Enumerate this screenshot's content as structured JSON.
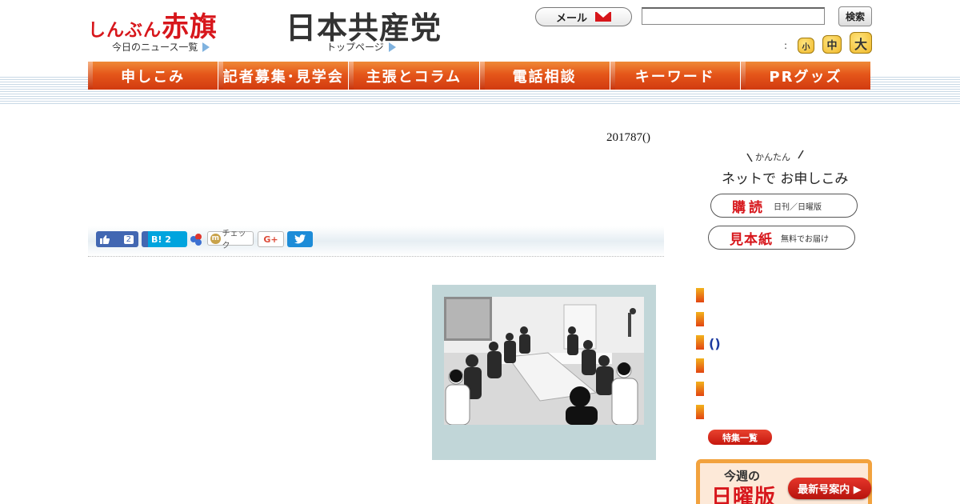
{
  "header": {
    "logo_small": "しんぶん",
    "logo_big": "赤旗",
    "news_link": "今日のニュース一覧",
    "party_logo": "日本共産党",
    "top_link": "トップページ",
    "mail_label": "メール",
    "search_placeholder": "",
    "search_button": "検索",
    "font_size_colon": ":",
    "font_small": "小",
    "font_medium": "中",
    "font_large": "大"
  },
  "nav": {
    "items": [
      {
        "label": "申しこみ"
      },
      {
        "label": "記者募集･見学会"
      },
      {
        "label": "主張とコラム"
      },
      {
        "label": "電話相談"
      },
      {
        "label": "キーワード"
      },
      {
        "label": "PRグッズ"
      }
    ]
  },
  "article": {
    "date": "201787()"
  },
  "share": {
    "like_count": "2",
    "hatena_label": "B!",
    "hatena_count": "2",
    "check_label": "チェック",
    "gplus_label": "G+"
  },
  "sidebar": {
    "kantan": "かんたん",
    "net_prefix": "ネットで",
    "net_suffix": "お申しこみ",
    "subscribe_main": "購読",
    "subscribe_sub": "日刊／日曜版",
    "sample_main": "見本紙",
    "sample_sub": "無料でお届け",
    "paren_text": "()",
    "feature_button": "特集一覧",
    "sunday_week": "今週の",
    "sunday_title": "日曜版",
    "latest_button": "最新号案内 ▶"
  },
  "colors": {
    "brand_red": "#d7161b",
    "nav_orange": "#e5561a",
    "facebook_blue": "#4267b2",
    "hatena_blue": "#00a4de",
    "twitter_blue": "#1d8cd8",
    "photo_frame": "#c1d6d8"
  },
  "icons": {
    "mail": "envelope-icon",
    "like": "thumbs-up-icon",
    "tweet": "twitter-bird-icon",
    "mixi": "mixi-icon"
  }
}
